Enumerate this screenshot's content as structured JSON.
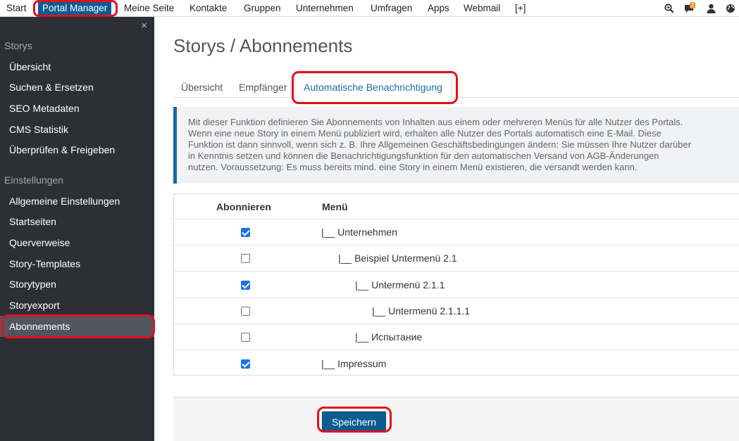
{
  "topnav": {
    "items": [
      "Start",
      "Portal Manager",
      "Meine Seite",
      "Kontakte",
      "Gruppen",
      "Unternehmen",
      "Umfragen",
      "Apps",
      "Webmail",
      "[+]"
    ],
    "notification_count": "1",
    "icons": [
      "search-plus-icon",
      "chat-icon",
      "user-icon",
      "globe-icon"
    ]
  },
  "sidebar": {
    "close_label": "×",
    "sections": [
      {
        "heading": "Storys",
        "items": [
          "Übersicht",
          "Suchen & Ersetzen",
          "SEO Metadaten",
          "CMS Statistik",
          "Überprüfen & Freigeben"
        ]
      },
      {
        "heading": "Einstellungen",
        "items": [
          "Allgemeine Einstellungen",
          "Startseiten",
          "Querverweise",
          "Story-Templates",
          "Storytypen",
          "Storyexport",
          "Abonnements"
        ]
      }
    ],
    "active_item": "Abonnements"
  },
  "main": {
    "title": "Storys / Abonnements",
    "tabs": [
      "Übersicht",
      "Empfänger",
      "Automatische Benachrichtigung"
    ],
    "active_tab": "Automatische Benachrichtigung",
    "info_lines": [
      "Mit dieser Funktion definieren Sie Abonnements von Inhalten aus einem oder mehreren Menüs für alle Nutzer des Portals.",
      "Wenn eine neue Story in einem Menü publiziert wird, erhalten alle Nutzer des Portals automatisch eine E-Mail. Diese",
      "Funktion ist dann sinnvoll, wenn sich z. B. Ihre Allgemeinen Geschäftsbedingungen ändern: Sie müssen Ihre Nutzer darüber",
      "in Kenntnis setzen und können die Benachrichtigungsfunktion für den automatischen Versand von AGB-Änderungen",
      "nutzen. Voraussetzung: Es muss bereits mind. eine Story in einem Menü existieren, die versandt werden kann."
    ],
    "table": {
      "headers": [
        "Abonnieren",
        "Menü"
      ],
      "rows": [
        {
          "checked": true,
          "label": "|__ Unternehmen",
          "depth": 0
        },
        {
          "checked": false,
          "label": "|__ Beispiel Untermenü 2.1",
          "depth": 1
        },
        {
          "checked": true,
          "label": "|__ Untermenü 2.1.1",
          "depth": 2
        },
        {
          "checked": false,
          "label": "|__ Untermenü 2.1.1.1",
          "depth": 3
        },
        {
          "checked": false,
          "label": "|__ Испытание",
          "depth": 2
        },
        {
          "checked": true,
          "label": "|__ Impressum",
          "depth": 0
        }
      ]
    },
    "save_label": "Speichern"
  },
  "colors": {
    "primary": "#0d5c91",
    "sidebar_bg": "#2c3036",
    "sidebar_active": "#51565e",
    "highlight": "#e3101b",
    "checkbox": "#1a73e8"
  }
}
